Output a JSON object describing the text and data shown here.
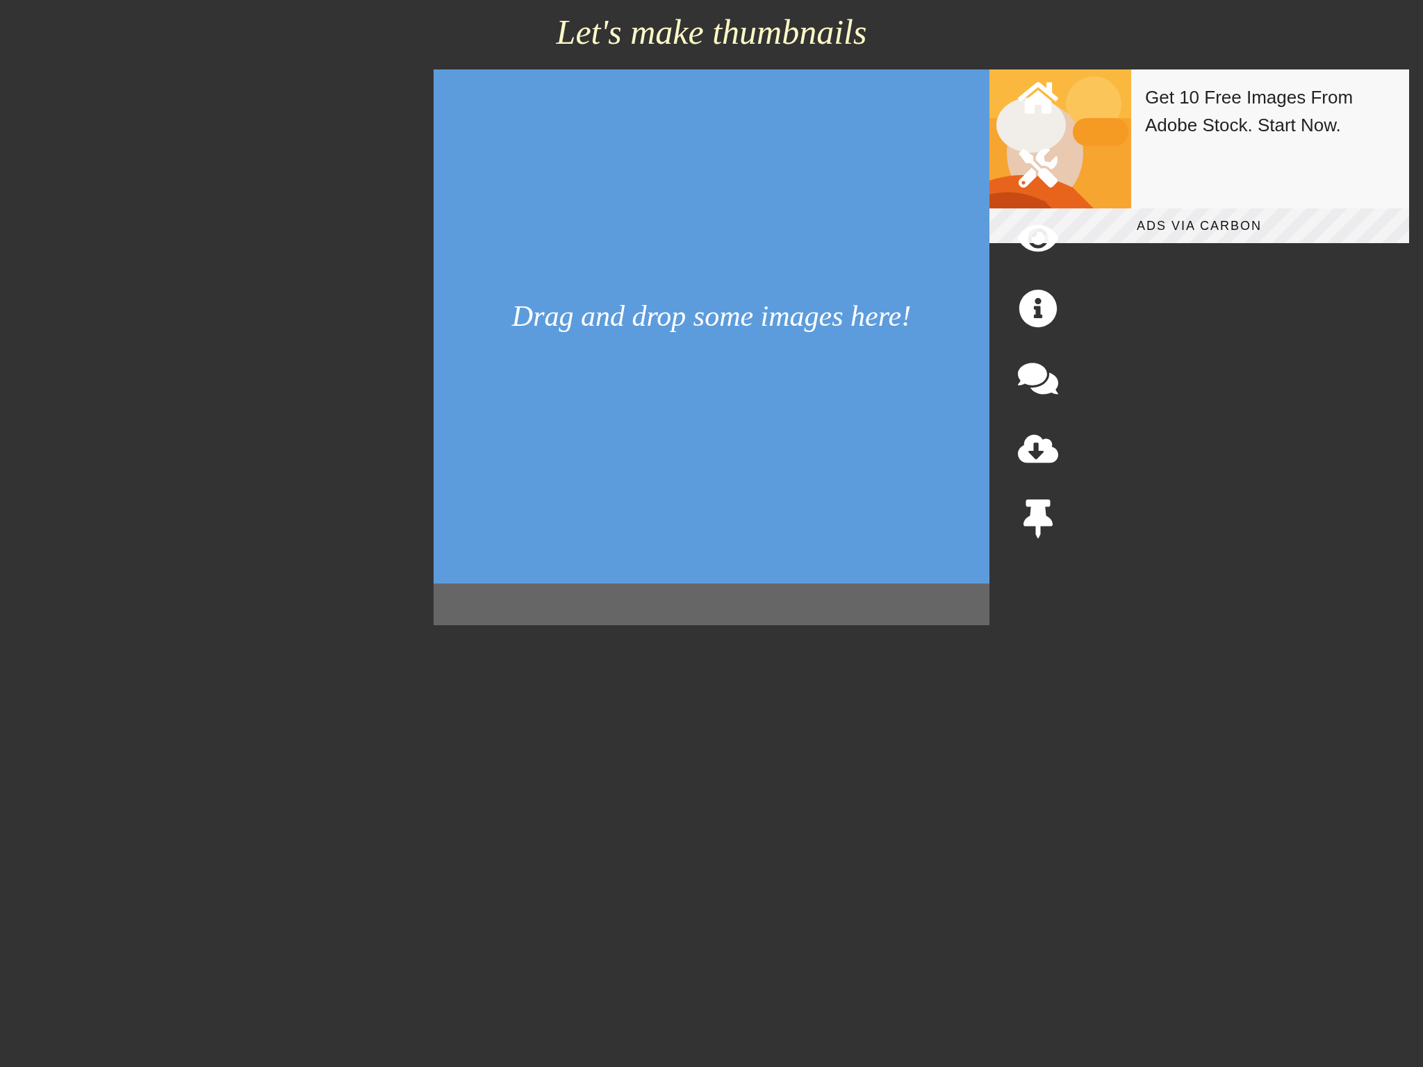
{
  "title": "Let's make thumbnails",
  "dropzone": {
    "message": "Drag and drop some images here!"
  },
  "ad": {
    "text": "Get 10 Free Images From Adobe Stock. Start Now.",
    "footer": "ADS VIA CARBON"
  }
}
